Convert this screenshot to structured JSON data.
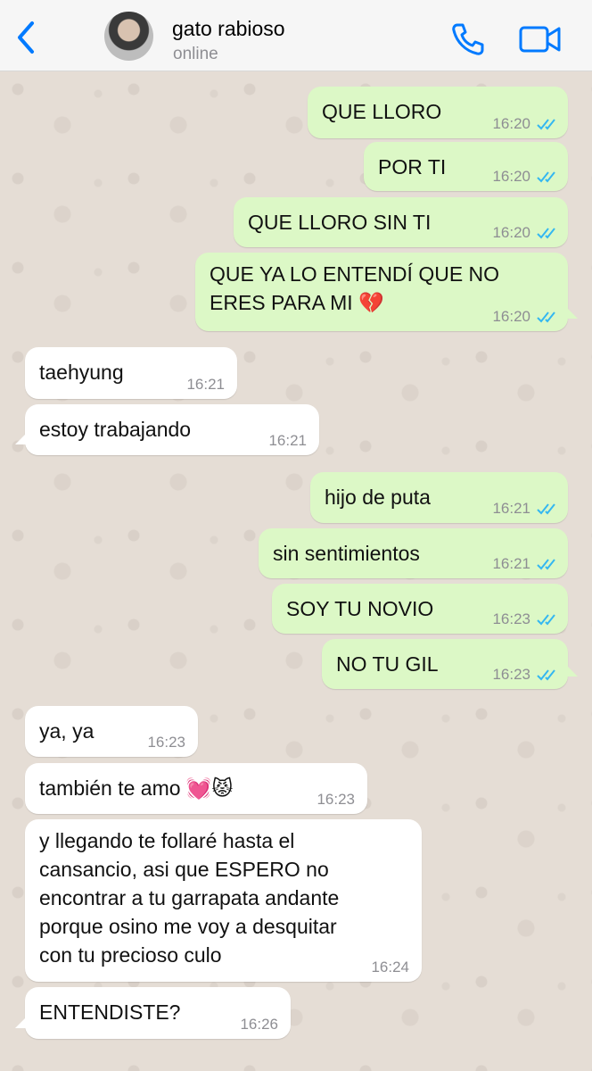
{
  "header": {
    "contact_name": "gato rabioso",
    "status": "online",
    "accent": "#007aff"
  },
  "messages": [
    {
      "dir": "out",
      "text": "QUE LLORO",
      "time": "16:20"
    },
    {
      "dir": "out",
      "text": "POR TI",
      "time": "16:20"
    },
    {
      "dir": "out",
      "text": "QUE LLORO SIN TI",
      "time": "16:20"
    },
    {
      "dir": "out",
      "text": "QUE YA LO ENTENDÍ QUE NO\nERES PARA MI 💔",
      "time": "16:20"
    },
    {
      "dir": "in",
      "text": "taehyung",
      "time": "16:21"
    },
    {
      "dir": "in",
      "text": "estoy trabajando",
      "time": "16:21"
    },
    {
      "dir": "out",
      "text": "hijo de puta",
      "time": "16:21"
    },
    {
      "dir": "out",
      "text": "sin sentimientos",
      "time": "16:21"
    },
    {
      "dir": "out",
      "text": "SOY TU NOVIO",
      "time": "16:23"
    },
    {
      "dir": "out",
      "text": "NO TU GIL",
      "time": "16:23"
    },
    {
      "dir": "in",
      "text": "ya, ya",
      "time": "16:23"
    },
    {
      "dir": "in",
      "text": "también te amo 💓😾",
      "time": "16:23"
    },
    {
      "dir": "in",
      "text": "y llegando te follaré hasta el\ncansancio, asi que ESPERO no\nencontrar a tu garrapata andante\nporque osino me voy a desquitar\ncon tu precioso culo",
      "time": "16:24"
    },
    {
      "dir": "in",
      "text": "ENTENDISTE?",
      "time": "16:26"
    }
  ]
}
